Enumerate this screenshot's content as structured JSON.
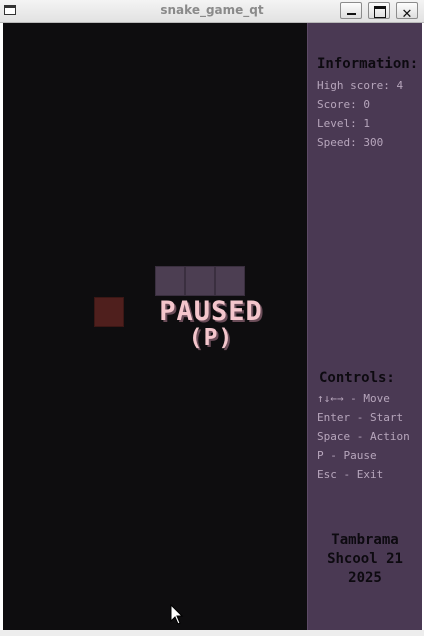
{
  "window": {
    "title": "snake_game_qt",
    "close_glyph": "✕",
    "icons": [
      "app-icon",
      "minimize-icon",
      "maximize-icon",
      "close-icon"
    ]
  },
  "game": {
    "paused_title": "PAUSED",
    "paused_hint": "(P)",
    "snake_segments": 3,
    "food_count": 1,
    "colors": {
      "field": "#0e0d0f",
      "snake": "#4c3e52",
      "food": "#4f1f1d",
      "overlay_text": "#f4c6cc",
      "panel": "#4a3953"
    }
  },
  "info": {
    "heading": "Information:",
    "high_score": "High score: 4",
    "score": "Score: 0",
    "level": "Level: 1",
    "speed": "Speed: 300"
  },
  "controls": {
    "heading": "Controls:",
    "move": "↑↓←→ - Move",
    "start": "Enter - Start",
    "action": "Space - Action",
    "pause": "P - Pause",
    "exit": "Esc - Exit"
  },
  "credit": {
    "line1": "Tambrama",
    "line2": "Shcool 21",
    "line3": "2025"
  }
}
